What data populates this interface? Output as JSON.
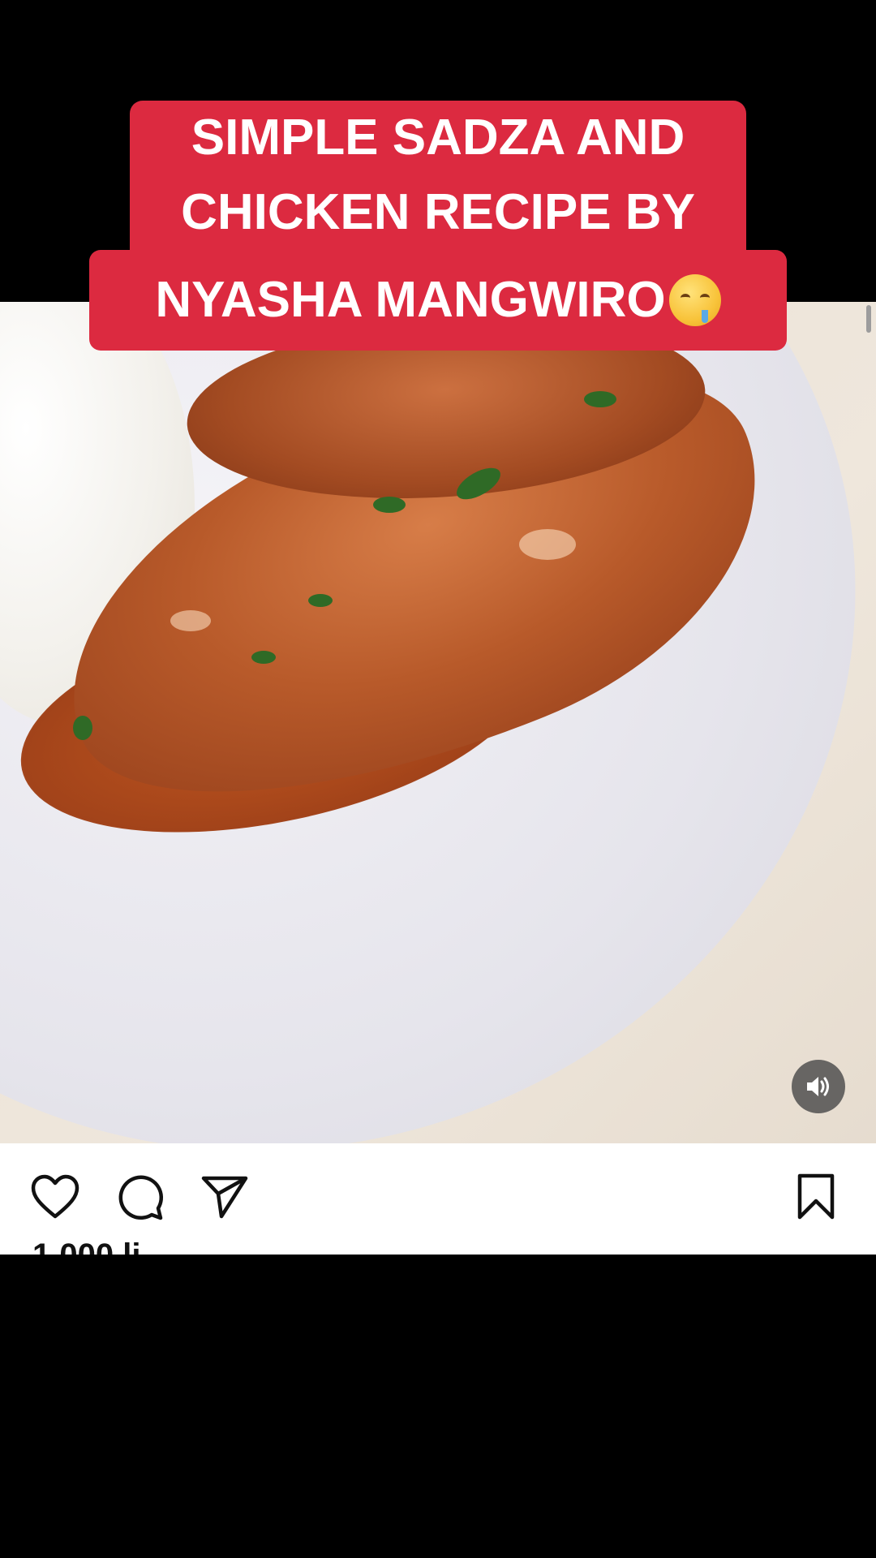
{
  "caption": {
    "line1": "SIMPLE SADZA AND",
    "line2": "CHICKEN RECIPE BY",
    "line3": "NYASHA MANGWIRO"
  },
  "icons": {
    "caption_emoji": "drooling-face-icon",
    "sound": "speaker-icon",
    "like": "heart-icon",
    "comment": "comment-icon",
    "share": "paper-plane-icon",
    "save": "bookmark-icon"
  },
  "post": {
    "likes_partial": "1,000 li"
  },
  "colors": {
    "caption_bg": "#dc2a40",
    "caption_text": "#ffffff",
    "actions_bg": "#ffffff",
    "background": "#000000"
  }
}
